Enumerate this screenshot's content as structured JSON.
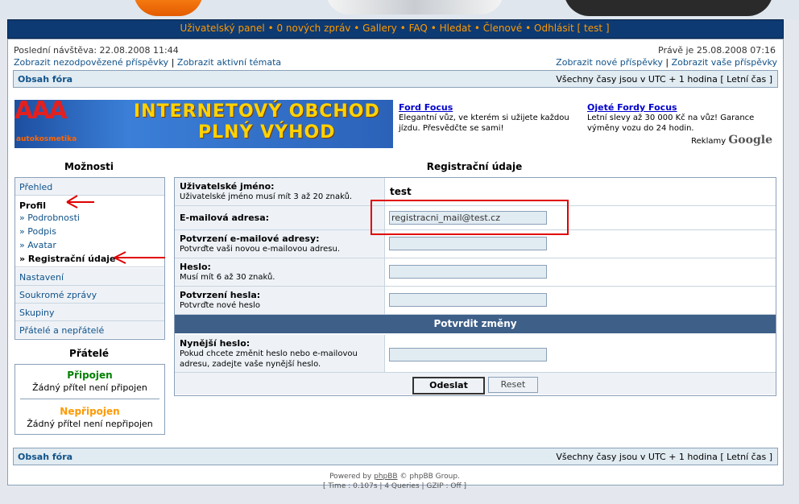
{
  "nav": {
    "items": [
      "Uživatelský panel",
      "0 nových zpráv",
      "Gallery",
      "FAQ",
      "Hledat",
      "Členové",
      "Odhlásit [ test ]"
    ],
    "separator": "•"
  },
  "info": {
    "last_visit": "Poslední návštěva: 22.08.2008 11:44",
    "now": "Právě je 25.08.2008 07:16",
    "link_unanswered": "Zobrazit nezodpovězené příspěvky",
    "link_active": "Zobrazit aktivní témata",
    "link_new": "Zobrazit nové příspěvky",
    "link_yours": "Zobrazit vaše příspěvky",
    "pipe": "|"
  },
  "breadcrumb": {
    "index": "Obsah fóra",
    "timezone": "Všechny časy jsou v UTC + 1 hodina [ Letní čas ]"
  },
  "ad": {
    "aaa": "AAA",
    "aaa_sub": "autokosmetika",
    "line1": "INTERNETOVÝ OBCHOD",
    "line2": "PLNÝ VÝHOD",
    "g1_title": "Ford Focus",
    "g1_text": "Elegantní vůz, ve kterém si užijete každou jízdu. Přesvědčte se sami!",
    "g2_title": "Ojeté Fordy Focus",
    "g2_text": "Letní slevy až 30 000 Kč na vůz! Garance výměny vozu do 24 hodin.",
    "brand_prefix": "Reklamy",
    "brand": "Google"
  },
  "options": {
    "title": "Možnosti",
    "overview": "Přehled",
    "profile": "Profil",
    "profile_items": [
      "» Podrobnosti",
      "» Podpis",
      "» Avatar",
      "» Registrační údaje"
    ],
    "settings": "Nastavení",
    "pm": "Soukromé zprávy",
    "groups": "Skupiny",
    "friends_foes": "Přátelé a nepřátelé"
  },
  "friends": {
    "title": "Přátelé",
    "online": "Připojen",
    "online_none": "Žádný přítel není připojen",
    "offline": "Nepřipojen",
    "offline_none": "Žádný přítel není nepřipojen",
    "online_color": "#008000",
    "offline_color": "#ff9900"
  },
  "form": {
    "title": "Registrační údaje",
    "username_label": "Uživatelské jméno:",
    "username_desc": "Uživatelské jméno musí mít 3 až 20 znaků.",
    "username_value": "test",
    "email_label": "E-mailová adresa:",
    "email_value": "registracni_mail@test.cz",
    "email_confirm_label": "Potvrzení e-mailové adresy:",
    "email_confirm_desc": "Potvrďte vaši novou e-mailovou adresu.",
    "password_label": "Heslo:",
    "password_desc": "Musí mít 6 až 30 znaků.",
    "password_confirm_label": "Potvrzení hesla:",
    "password_confirm_desc": "Potvrďte nové heslo",
    "confirm_section": "Potvrdit změny",
    "current_password_label": "Nynější heslo:",
    "current_password_desc": "Pokud chcete změnit heslo nebo e-mailovou adresu, zadejte vaše nynější heslo.",
    "submit": "Odeslat",
    "reset": "Reset"
  },
  "footer": {
    "powered_prefix": "Powered by ",
    "powered_link": "phpBB",
    "powered_suffix": " © phpBB Group.",
    "stats": "[ Time : 0.107s | 4 Queries | GZIP : Off ]"
  },
  "colors": {
    "annotation": "#e00000",
    "header": "#0d3a72",
    "accent": "#ff9900"
  }
}
